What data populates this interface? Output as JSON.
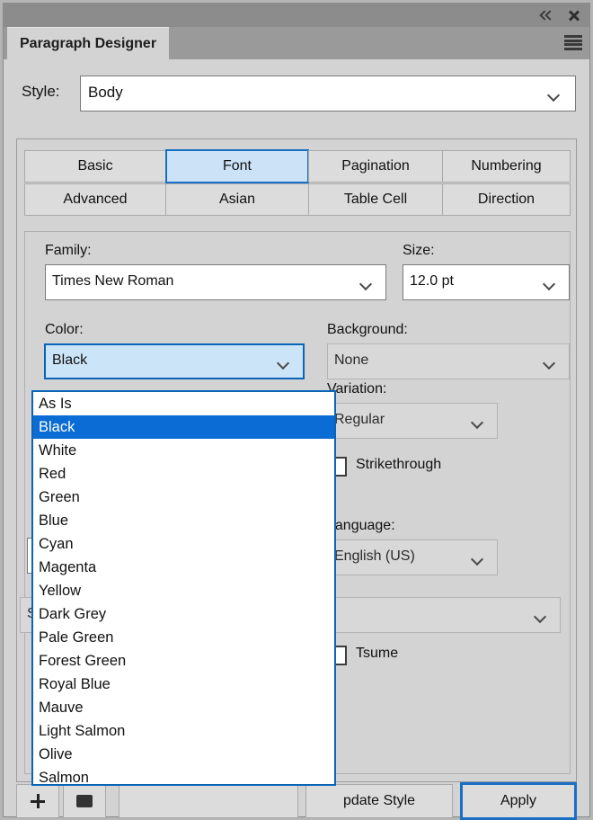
{
  "window": {
    "title": "Paragraph Designer",
    "collapse_icon": "double-chevron-left-icon",
    "close_icon": "close-icon",
    "menu_icon": "hamburger-menu-icon"
  },
  "style_row": {
    "label": "Style:",
    "value": "Body",
    "caret_icon": "chevron-down-icon"
  },
  "tabs": [
    {
      "label": "Basic",
      "active": false
    },
    {
      "label": "Font",
      "active": true
    },
    {
      "label": "Pagination",
      "active": false
    },
    {
      "label": "Numbering",
      "active": false
    },
    {
      "label": "Advanced",
      "active": false
    },
    {
      "label": "Asian",
      "active": false
    },
    {
      "label": "Table Cell",
      "active": false
    },
    {
      "label": "Direction",
      "active": false
    }
  ],
  "font_panel": {
    "family_label": "Family:",
    "family_value": "Times New Roman",
    "size_label": "Size:",
    "size_value": "12.0 pt",
    "color_label": "Color:",
    "color_value": "Black",
    "background_label": "Background:",
    "background_value": "None",
    "variation_label": "Variation:",
    "variation_value": "Regular",
    "strikethrough_label": "Strikethrough",
    "strikethrough_checked": false,
    "language_label": "Language:",
    "language_value": "English (US)",
    "caps_value": "Small Caps",
    "tsume_label": "Tsume",
    "tsume_checked": false
  },
  "color_dropdown": {
    "open": true,
    "selected": "Black",
    "options": [
      "As Is",
      "Black",
      "White",
      "Red",
      "Green",
      "Blue",
      "Cyan",
      "Magenta",
      "Yellow",
      "Dark Grey",
      "Pale Green",
      "Forest Green",
      "Royal Blue",
      "Mauve",
      "Light Salmon",
      "Olive",
      "Salmon"
    ]
  },
  "footer": {
    "new_icon": "plus-icon",
    "brush_icon": "brush-icon",
    "update_style_label": "pdate Style",
    "apply_label": "Apply"
  },
  "colors": {
    "accent": "#0a64b8",
    "selection": "#0a6cd4",
    "panel_bg": "#d3d3d3",
    "titlebar": "#8c8c8c"
  }
}
